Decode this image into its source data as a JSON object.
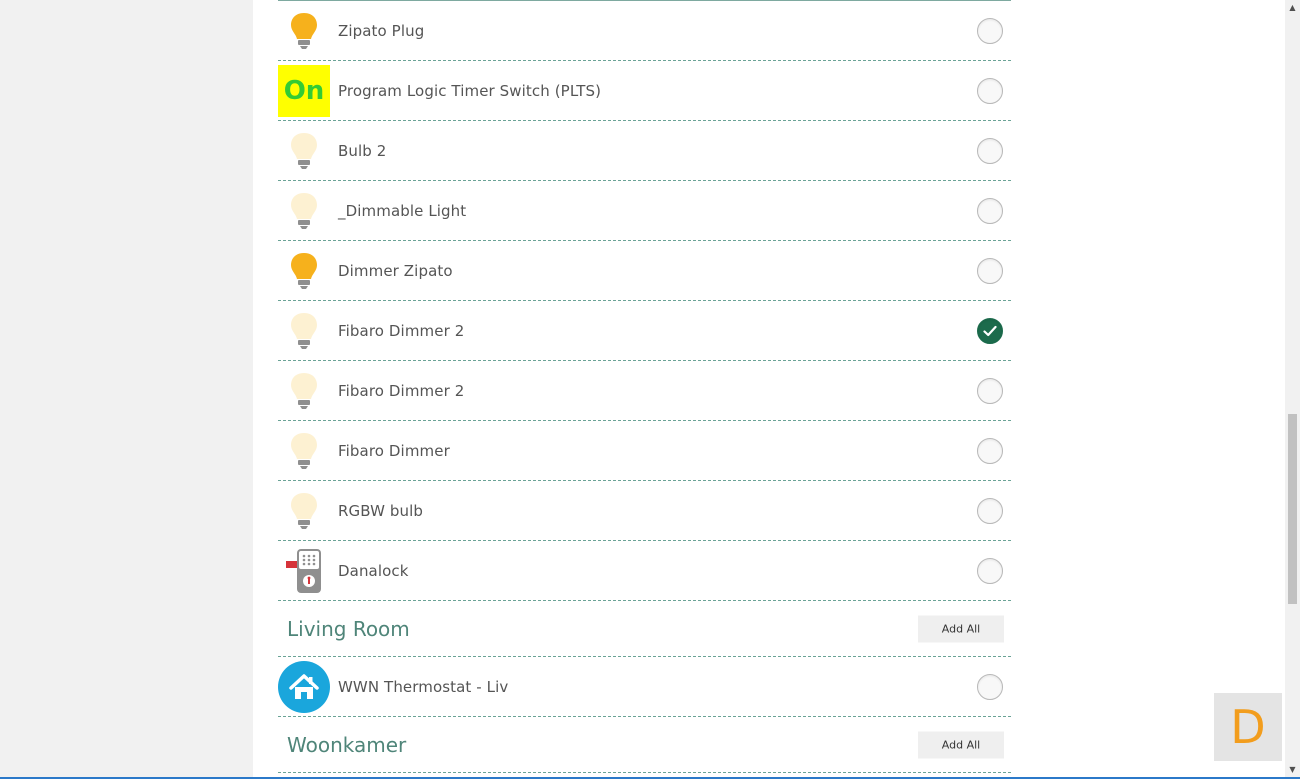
{
  "devices_top": [
    {
      "name": "Zipato Plug",
      "icon": "bulb-on-icon",
      "checked": false
    },
    {
      "name": "Program Logic Timer Switch (PLTS)",
      "icon": "on-badge-icon",
      "badge_text": "On",
      "checked": false
    },
    {
      "name": "Bulb 2",
      "icon": "bulb-off-icon",
      "checked": false
    },
    {
      "name": "_Dimmable Light",
      "icon": "bulb-off-icon",
      "checked": false
    },
    {
      "name": "Dimmer Zipato",
      "icon": "bulb-on-icon",
      "checked": false
    },
    {
      "name": "Fibaro Dimmer 2",
      "icon": "bulb-off-icon",
      "checked": true
    },
    {
      "name": "Fibaro Dimmer 2",
      "icon": "bulb-off-icon",
      "checked": false
    },
    {
      "name": "Fibaro Dimmer",
      "icon": "bulb-off-icon",
      "checked": false
    },
    {
      "name": "RGBW bulb",
      "icon": "bulb-off-icon",
      "checked": false
    },
    {
      "name": "Danalock",
      "icon": "lock-icon",
      "checked": false
    }
  ],
  "rooms": [
    {
      "title": "Living Room",
      "add_all_label": "Add All",
      "devices": [
        {
          "name": "WWN Thermostat - Liv",
          "icon": "home-icon",
          "checked": false
        }
      ]
    },
    {
      "title": "Woonkamer",
      "add_all_label": "Add All",
      "devices": []
    }
  ],
  "floating_button": {
    "label": "D",
    "icon": "d-logo-icon",
    "color": "#f29d1d"
  },
  "colors": {
    "accent": "#4f8579",
    "check_selected": "#1c6b4c",
    "bulb_on": "#f6b11c",
    "bulb_off": "#fdf1d2"
  }
}
